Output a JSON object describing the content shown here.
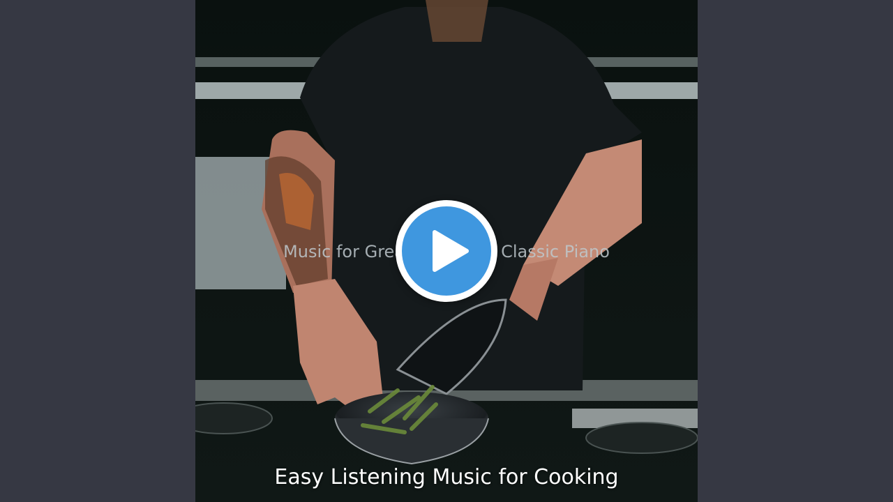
{
  "video": {
    "overlay_title": "Music for Great Cooking - Classic Piano",
    "caption": "Easy Listening Music for Cooking"
  },
  "controls": {
    "play_icon": "play-icon",
    "play_color": "#3f97df"
  },
  "colors": {
    "page_background": "#363843",
    "caption_text": "#ffffff"
  }
}
